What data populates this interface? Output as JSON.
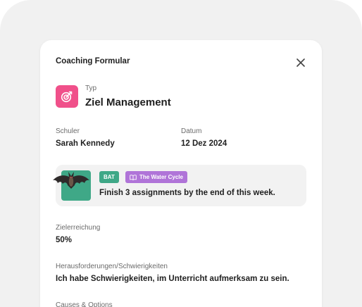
{
  "form": {
    "title": "Coaching Formular",
    "type_label": "Typ",
    "type_value": "Ziel Management",
    "student_label": "Schuler",
    "student_value": "Sarah Kennedy",
    "date_label": "Datum",
    "date_value": "12 Dez 2024",
    "activity": {
      "tag_category": "BAT",
      "tag_topic": "The Water Cycle",
      "goal_text": "Finish 3 assignments by the end of this week."
    },
    "achievement_label": "Zielerreichung",
    "achievement_value": "50%",
    "challenges_label": "Herausforderungen/Schwierigkeiten",
    "challenges_value": "Ich habe Schwierigkeiten, im Unterricht aufmerksam zu sein.",
    "causes_label": "Causes & Options"
  },
  "icons": {
    "close": "close-icon",
    "type": "target-icon",
    "topic": "book-icon"
  },
  "colors": {
    "type_icon_bg": "#f0508a",
    "tag_category_bg": "#3fa887",
    "tag_topic_bg": "#b074d8",
    "device_bg": "#f1f1f1"
  }
}
